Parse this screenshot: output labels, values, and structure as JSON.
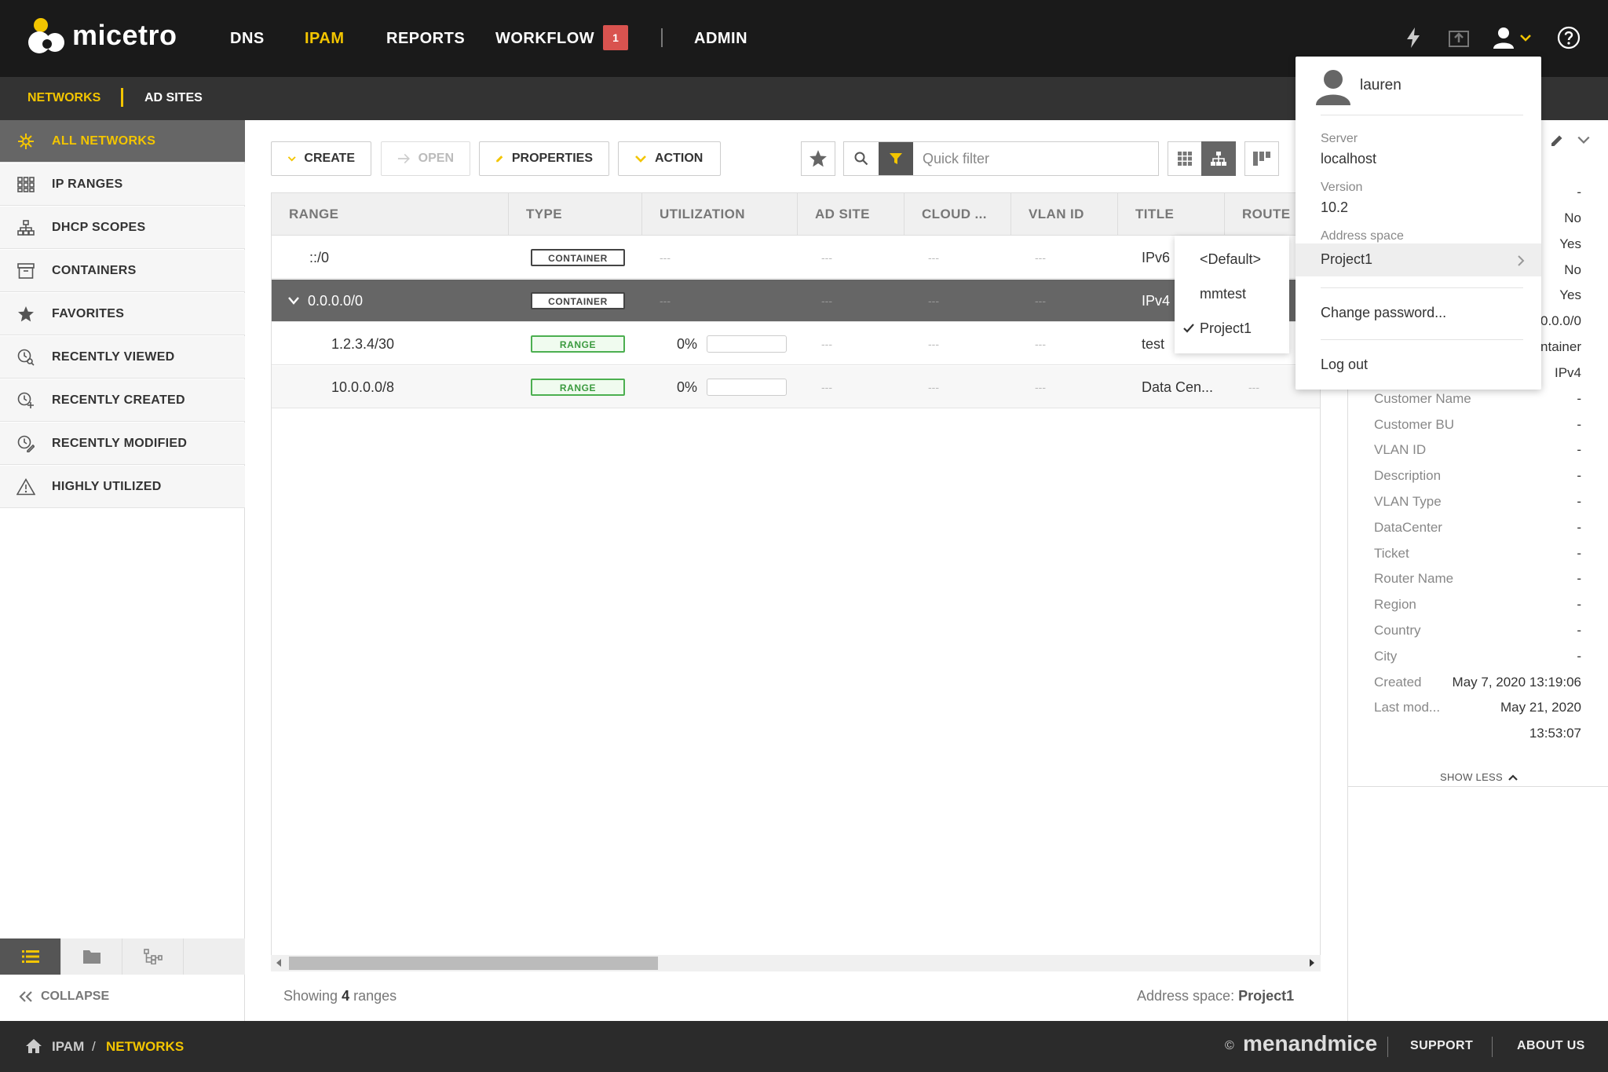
{
  "app": {
    "name": "micetro"
  },
  "nav": {
    "items": [
      {
        "label": "DNS"
      },
      {
        "label": "IPAM"
      },
      {
        "label": "REPORTS"
      },
      {
        "label": "WORKFLOW"
      },
      {
        "label": "ADMIN"
      }
    ],
    "active": "IPAM",
    "workflow_badge": "1"
  },
  "subnav": {
    "items": [
      {
        "label": "NETWORKS"
      },
      {
        "label": "AD SITES"
      }
    ],
    "active": "NETWORKS"
  },
  "sidebar": {
    "items": [
      {
        "label": "ALL NETWORKS",
        "icon": "network-icon"
      },
      {
        "label": "IP RANGES",
        "icon": "ip-ranges-icon"
      },
      {
        "label": "DHCP SCOPES",
        "icon": "dhcp-scopes-icon"
      },
      {
        "label": "CONTAINERS",
        "icon": "containers-icon"
      },
      {
        "label": "FAVORITES",
        "icon": "star-icon"
      },
      {
        "label": "RECENTLY VIEWED",
        "icon": "recently-viewed-icon"
      },
      {
        "label": "RECENTLY CREATED",
        "icon": "recently-created-icon"
      },
      {
        "label": "RECENTLY MODIFIED",
        "icon": "recently-modified-icon"
      },
      {
        "label": "HIGHLY UTILIZED",
        "icon": "warning-icon"
      }
    ],
    "active": "ALL NETWORKS",
    "collapse_label": "COLLAPSE"
  },
  "toolbar": {
    "create": "CREATE",
    "open": "OPEN",
    "properties": "PROPERTIES",
    "action": "ACTION",
    "filter_placeholder": "Quick filter"
  },
  "table": {
    "columns": [
      "RANGE",
      "TYPE",
      "UTILIZATION",
      "AD SITE",
      "CLOUD ...",
      "VLAN ID",
      "TITLE",
      "ROUTE"
    ],
    "empty": "---",
    "rows": [
      {
        "range": "::/0",
        "type": "CONTAINER",
        "utilization": "",
        "title": "IPv6",
        "expanded": false,
        "selected": false
      },
      {
        "range": "0.0.0.0/0",
        "type": "CONTAINER",
        "utilization": "",
        "title": "IPv4",
        "expanded": true,
        "selected": true
      },
      {
        "range": "1.2.3.4/30",
        "type": "RANGE",
        "utilization": "0%",
        "title": "test",
        "selected": false
      },
      {
        "range": "10.0.0.0/8",
        "type": "RANGE",
        "utilization": "0%",
        "title": "Data Cen...",
        "selected": false
      }
    ]
  },
  "status": {
    "showing_prefix": "Showing",
    "showing_count": "4",
    "showing_suffix": "ranges",
    "address_space_label": "Address space:",
    "address_space_value": "Project1"
  },
  "props": {
    "partial_values": [
      "-",
      "No",
      "Yes",
      "No",
      "Yes",
      "0.0.0/0",
      "ntainer",
      "IPv4"
    ],
    "rows": [
      {
        "label": "Customer Name",
        "value": "-"
      },
      {
        "label": "Customer BU",
        "value": "-"
      },
      {
        "label": "VLAN ID",
        "value": "-"
      },
      {
        "label": "Description",
        "value": "-"
      },
      {
        "label": "VLAN Type",
        "value": "-"
      },
      {
        "label": "DataCenter",
        "value": "-"
      },
      {
        "label": "Ticket",
        "value": "-"
      },
      {
        "label": "Router Name",
        "value": "-"
      },
      {
        "label": "Region",
        "value": "-"
      },
      {
        "label": "Country",
        "value": "-"
      },
      {
        "label": "City",
        "value": "-"
      },
      {
        "label": "Created",
        "value": "May 7, 2020 13:19:06"
      },
      {
        "label": "Last mod...",
        "value": "May 21, 2020"
      }
    ],
    "last_mod_time": "13:53:07",
    "show_less": "SHOW LESS"
  },
  "user_menu": {
    "username": "lauren",
    "server_label": "Server",
    "server_value": "localhost",
    "version_label": "Version",
    "version_value": "10.2",
    "address_space_label": "Address space",
    "address_space_value": "Project1",
    "change_password": "Change password...",
    "logout": "Log out"
  },
  "address_spaces": {
    "options": [
      "<Default>",
      "mmtest",
      "Project1"
    ],
    "checked": "Project1"
  },
  "breadcrumb": {
    "items": [
      "IPAM",
      "NETWORKS"
    ],
    "separator": "/"
  },
  "footer": {
    "copyright": "©",
    "brand": "menandmice",
    "links": [
      "SUPPORT",
      "ABOUT US"
    ]
  },
  "colors": {
    "accent": "#f3c500",
    "topbar": "#1a1a1a",
    "badge": "#d9534f",
    "range_tag": "#4caf50"
  }
}
